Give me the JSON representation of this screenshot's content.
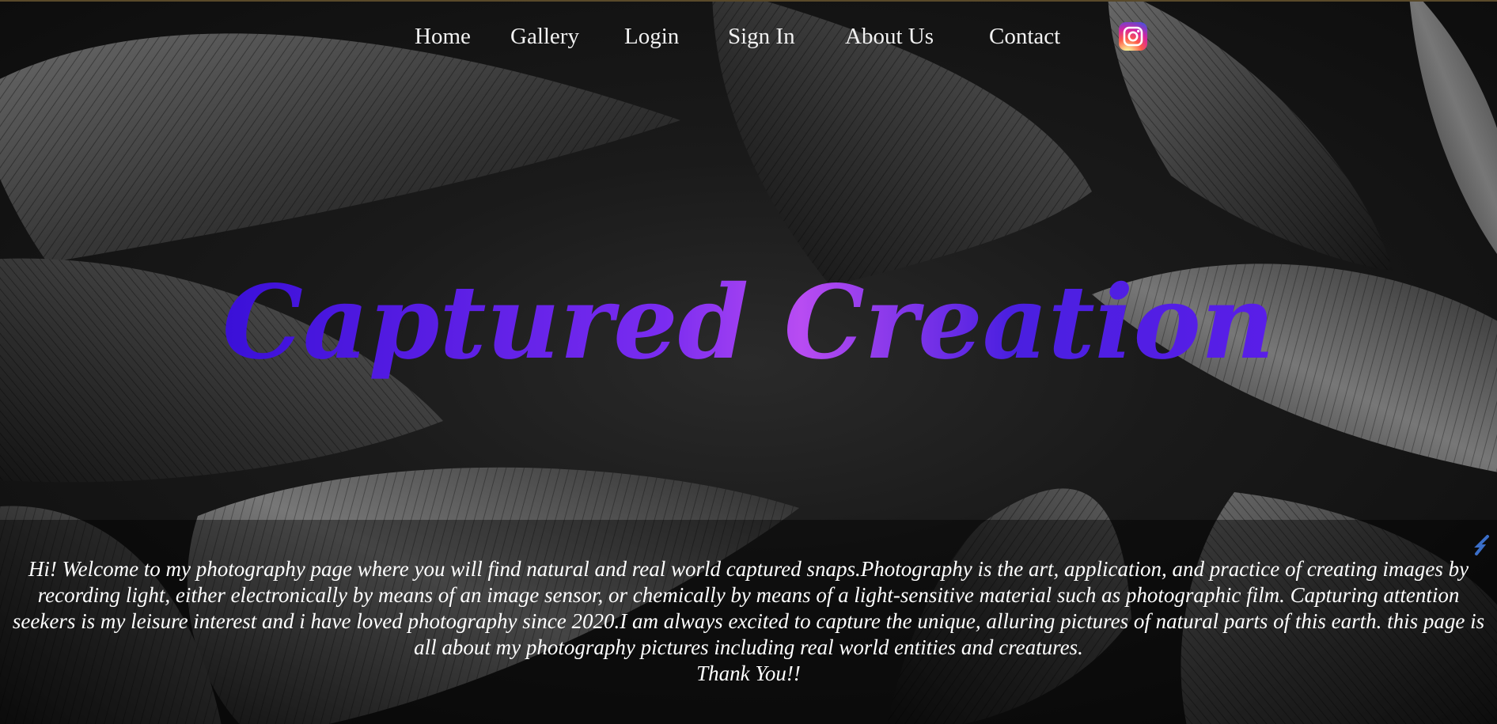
{
  "nav": {
    "items": [
      {
        "label": "Home"
      },
      {
        "label": "Gallery"
      },
      {
        "label": "Login"
      },
      {
        "label": "Sign In"
      },
      {
        "label": "About Us"
      },
      {
        "label": "Contact"
      }
    ],
    "social_icon": "instagram-icon"
  },
  "hero": {
    "title": "Captured Creation",
    "title_colors": [
      "#3a10d8",
      "#7a2cf0",
      "#b84cf2",
      "#4a1fe0"
    ]
  },
  "about": {
    "paragraph": "Hi! Welcome to my photography page where you will find natural and real world captured snaps.Photography is the art, application, and practice of creating images by recording light, either electronically by means of an image sensor, or chemically by means of a light-sensitive material such as photographic film. Capturing attention seekers is my leisure interest and i have loved photography since 2020.I am always excited to capture the unique, alluring pictures of natural parts of this earth. this page is all about my photography pictures including real world entities and creatures.",
    "thanks": "Thank You!!"
  },
  "colors": {
    "text": "#ffffff",
    "background": "#111111"
  }
}
